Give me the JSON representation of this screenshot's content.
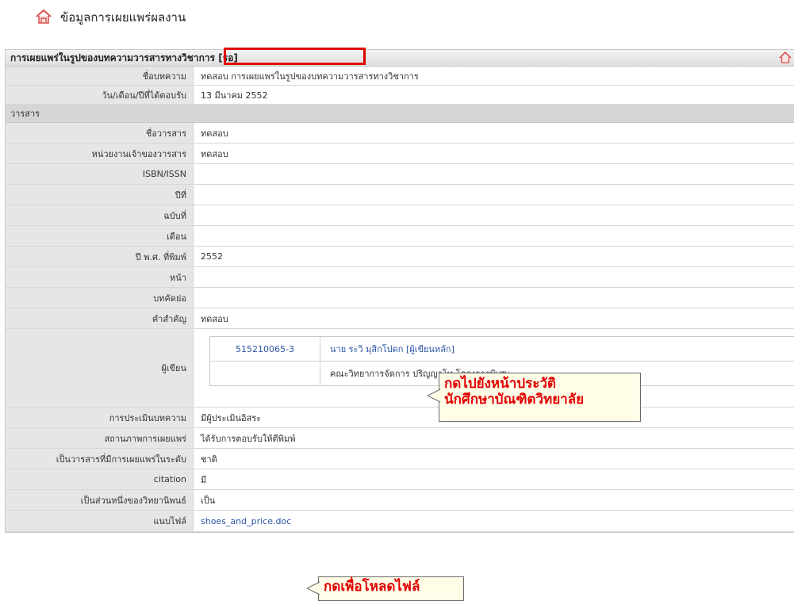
{
  "page": {
    "title": "ข้อมูลการเผยแพร่ผลงาน"
  },
  "panel": {
    "title": "การเผยแพร่ในรูปของบทความวารสารทางวิชาการ [รอ]"
  },
  "fields": {
    "article_name": {
      "label": "ชื่อบทความ",
      "value": "ทดสอบ การเผยแพร่ในรูปของบทความวารสารทางวิชาการ"
    },
    "accepted_date": {
      "label": "วัน/เดือน/ปีที่ได้ตอบรับ",
      "value": "13 มีนาคม 2552"
    }
  },
  "journal_section": {
    "label": "วารสาร"
  },
  "journal": {
    "name": {
      "label": "ชื่อวารสาร",
      "value": "ทดสอบ"
    },
    "owner": {
      "label": "หน่วยงานเจ้าของวารสาร",
      "value": "ทดสอบ"
    },
    "isbn": {
      "label": "ISBN/ISSN",
      "value": ""
    },
    "year": {
      "label": "ปีที่",
      "value": ""
    },
    "issue": {
      "label": "ฉบับที่",
      "value": ""
    },
    "month": {
      "label": "เดือน",
      "value": ""
    },
    "publish_year": {
      "label": "ปี พ.ศ. ที่พิมพ์",
      "value": "2552"
    },
    "page": {
      "label": "หน้า",
      "value": ""
    },
    "abstract": {
      "label": "บทคัดย่อ",
      "value": ""
    },
    "keywords": {
      "label": "คำสำคัญ",
      "value": "ทดสอบ"
    }
  },
  "authors": {
    "label": "ผู้เขียน",
    "student_id": "515210065-3",
    "name": "นาย ระวิ มุสิกโปดก [ผู้เขียนหลัก]",
    "faculty": "คณะวิทยาการจัดการ ปริญญาโท โครงการพิเศษ"
  },
  "details": {
    "review": {
      "label": "การประเมินบทความ",
      "value": "มีผู้ประเมินอิสระ"
    },
    "status": {
      "label": "สถานภาพการเผยแพร่",
      "value": "ได้รับการตอบรับให้ตีพิมพ์"
    },
    "level": {
      "label": "เป็นวารสารที่มีการเผยแพร่ในระดับ",
      "value": "ชาติ"
    },
    "citation": {
      "label": "citation",
      "value": "มี"
    },
    "thesis_part": {
      "label": "เป็นส่วนหนึ่งของวิทยานิพนธ์",
      "value": "เป็น"
    },
    "attachment": {
      "label": "แนบไฟล์",
      "value": "shoes_and_price.doc"
    }
  },
  "callouts": {
    "profile": "กดไปยังหน้าประวัติ\nนักศึกษาบัณฑิตวิทยาลัย",
    "download": "กดเพื่อโหลดไฟล์"
  },
  "icons": {
    "header": "house-icon",
    "panel": "house-icon"
  },
  "colors": {
    "highlight": "#e00000",
    "link": "#2a55a8",
    "label_bg": "#e6e6e6"
  }
}
